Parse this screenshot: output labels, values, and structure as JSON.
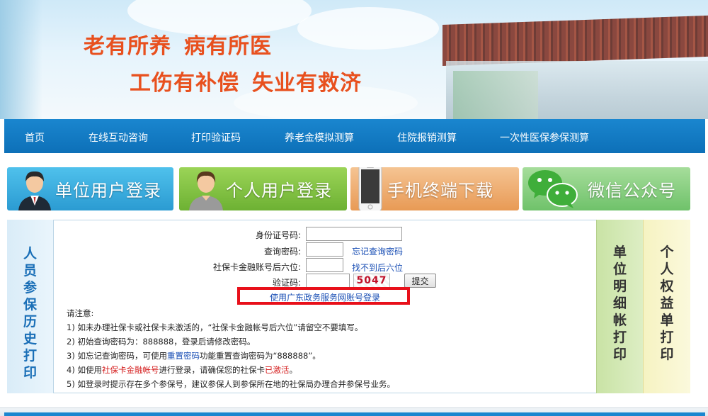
{
  "banner": {
    "slogan_line1_a": "老有所养",
    "slogan_line1_b": "病有所医",
    "slogan_line2_a": "工伤有补偿",
    "slogan_line2_b": "失业有救济",
    "slogan_color": "#e8501e"
  },
  "nav": {
    "items": [
      "首页",
      "在线互动咨询",
      "打印验证码",
      "养老金模拟测算",
      "住院报销测算",
      "一次性医保参保测算"
    ],
    "color": "#0d70b8"
  },
  "tiles": [
    {
      "label": "单位用户登录",
      "icon": "user-avatar-suit-icon"
    },
    {
      "label": "个人用户登录",
      "icon": "user-avatar-casual-icon"
    },
    {
      "label": "手机终端下载",
      "icon": "mobile-phone-icon"
    },
    {
      "label": "微信公众号",
      "icon": "wechat-icon"
    }
  ],
  "side": {
    "left": "人员参保历史打印",
    "right1": "单位明细帐打印",
    "right2": "个人权益单打印"
  },
  "form": {
    "id_label": "身份证号码:",
    "id_value": "",
    "pwd_label": "查询密码:",
    "pwd_value": "",
    "forgot_link": "忘记查询密码",
    "card_label": "社保卡金融账号后六位:",
    "card_value": "",
    "not_found_link": "找不到后六位",
    "captcha_label": "验证码:",
    "captcha_value": "",
    "captcha_code": "5047",
    "submit_label": "提交",
    "gd_login_link": "使用广东政务服务网账号登录"
  },
  "notes": {
    "title": "请注意:",
    "n1": "1) 如未办理社保卡或社保卡未激活的，“社保卡金融帐号后六位”请留空不要填写。",
    "n2": "2) 初始查询密码为：888888，登录后请修改密码。",
    "n3_a": "3) 如忘记查询密码，可使用",
    "n3_link": "重置密码",
    "n3_b": "功能重置查询密码为“888888”。",
    "n4_a": "4) 如使用",
    "n4_red1": "社保卡金融帐号",
    "n4_b": "进行登录，请确保您的社保卡",
    "n4_red2": "已激活",
    "n4_c": "。",
    "n5": "5) 如登录时提示存在多个参保号，建议参保人到参保所在地的社保局办理合并参保号业务。"
  }
}
